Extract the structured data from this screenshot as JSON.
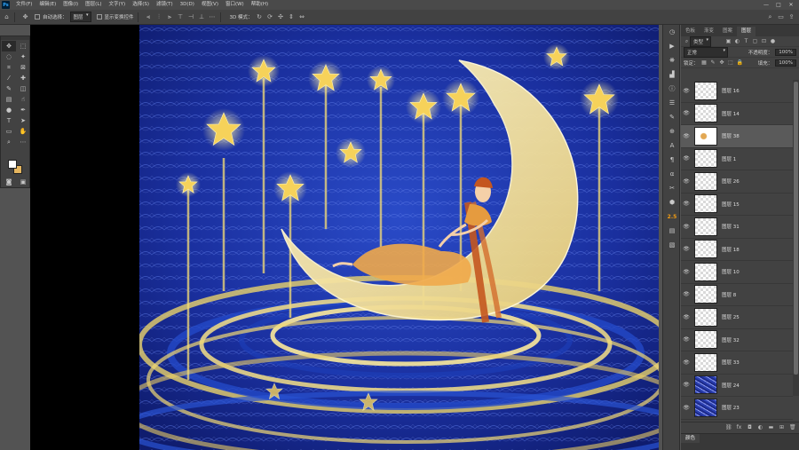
{
  "app": {
    "logo": "Ps"
  },
  "menu": [
    "文件(F)",
    "编辑(E)",
    "图像(I)",
    "图层(L)",
    "文字(Y)",
    "选择(S)",
    "滤镜(T)",
    "3D(D)",
    "视图(V)",
    "窗口(W)",
    "帮助(H)"
  ],
  "window_controls": [
    "—",
    "□",
    "✕"
  ],
  "options": {
    "auto_select_label": "自动选择：",
    "auto_select_value": "图层",
    "show_transform_label": "显示变换控件",
    "mode_label": "3D 模式："
  },
  "layers_panel": {
    "tabs": [
      "色板",
      "渐变",
      "图案",
      "图层"
    ],
    "filter_value": "类型",
    "blend_mode": "正常",
    "opacity_label": "不透明度：",
    "opacity_value": "100%",
    "lock_label": "锁定：",
    "fill_label": "填充：",
    "fill_value": "100%",
    "layers": [
      {
        "name": "图层 16",
        "thumb": "checker"
      },
      {
        "name": "图层 14",
        "thumb": "checker"
      },
      {
        "name": "图层 38",
        "thumb": "gold"
      },
      {
        "name": "图层 1",
        "thumb": "checker"
      },
      {
        "name": "图层 26",
        "thumb": "checker"
      },
      {
        "name": "图层 15",
        "thumb": "checker"
      },
      {
        "name": "图层 31",
        "thumb": "checker"
      },
      {
        "name": "图层 18",
        "thumb": "checker"
      },
      {
        "name": "图层 10",
        "thumb": "checker"
      },
      {
        "name": "图层 8",
        "thumb": "checker"
      },
      {
        "name": "图层 25",
        "thumb": "checker"
      },
      {
        "name": "图层 32",
        "thumb": "checker"
      },
      {
        "name": "图层 33",
        "thumb": "checker"
      },
      {
        "name": "图层 24",
        "thumb": "blue"
      },
      {
        "name": "图层 23",
        "thumb": "blue"
      }
    ],
    "selected_index": 2
  },
  "color_panel": {
    "tab": "颜色"
  },
  "colors": {
    "foreground": "#ffffff",
    "background": "#e6b65f",
    "accent": "#31a8ff"
  },
  "dock_badge": "2.5"
}
